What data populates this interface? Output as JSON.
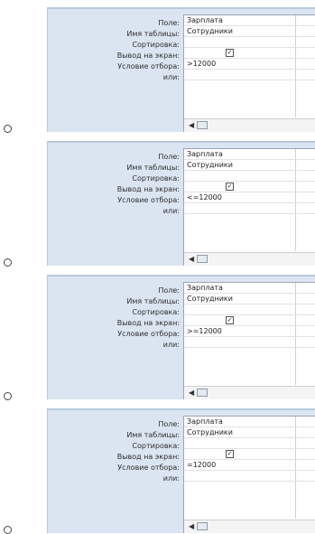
{
  "labels": {
    "field": "Поле:",
    "table": "Имя таблицы:",
    "sort": "Сортировка:",
    "show": "Вывод на экран:",
    "criteria": "Условие отбора:",
    "or": "или:"
  },
  "options": [
    {
      "field": "Зарплата",
      "table": "Сотрудники",
      "show": true,
      "criteria": ">12000"
    },
    {
      "field": "Зарплата",
      "table": "Сотрудники",
      "show": true,
      "criteria": "<=12000"
    },
    {
      "field": "Зарплата",
      "table": "Сотрудники",
      "show": true,
      "criteria": ">=12000"
    },
    {
      "field": "Зарплата",
      "table": "Сотрудники",
      "show": true,
      "criteria": "=12000"
    }
  ],
  "icons": {
    "checkbox": "checkbox-checked-icon",
    "scroll_left": "scroll-left-arrow-icon",
    "scroll_thumb": "scroll-thumb-icon",
    "radio": "radio-button-icon"
  },
  "colors": {
    "panel_bg": "#dbe5f1",
    "grid_bg": "#ffffff"
  }
}
